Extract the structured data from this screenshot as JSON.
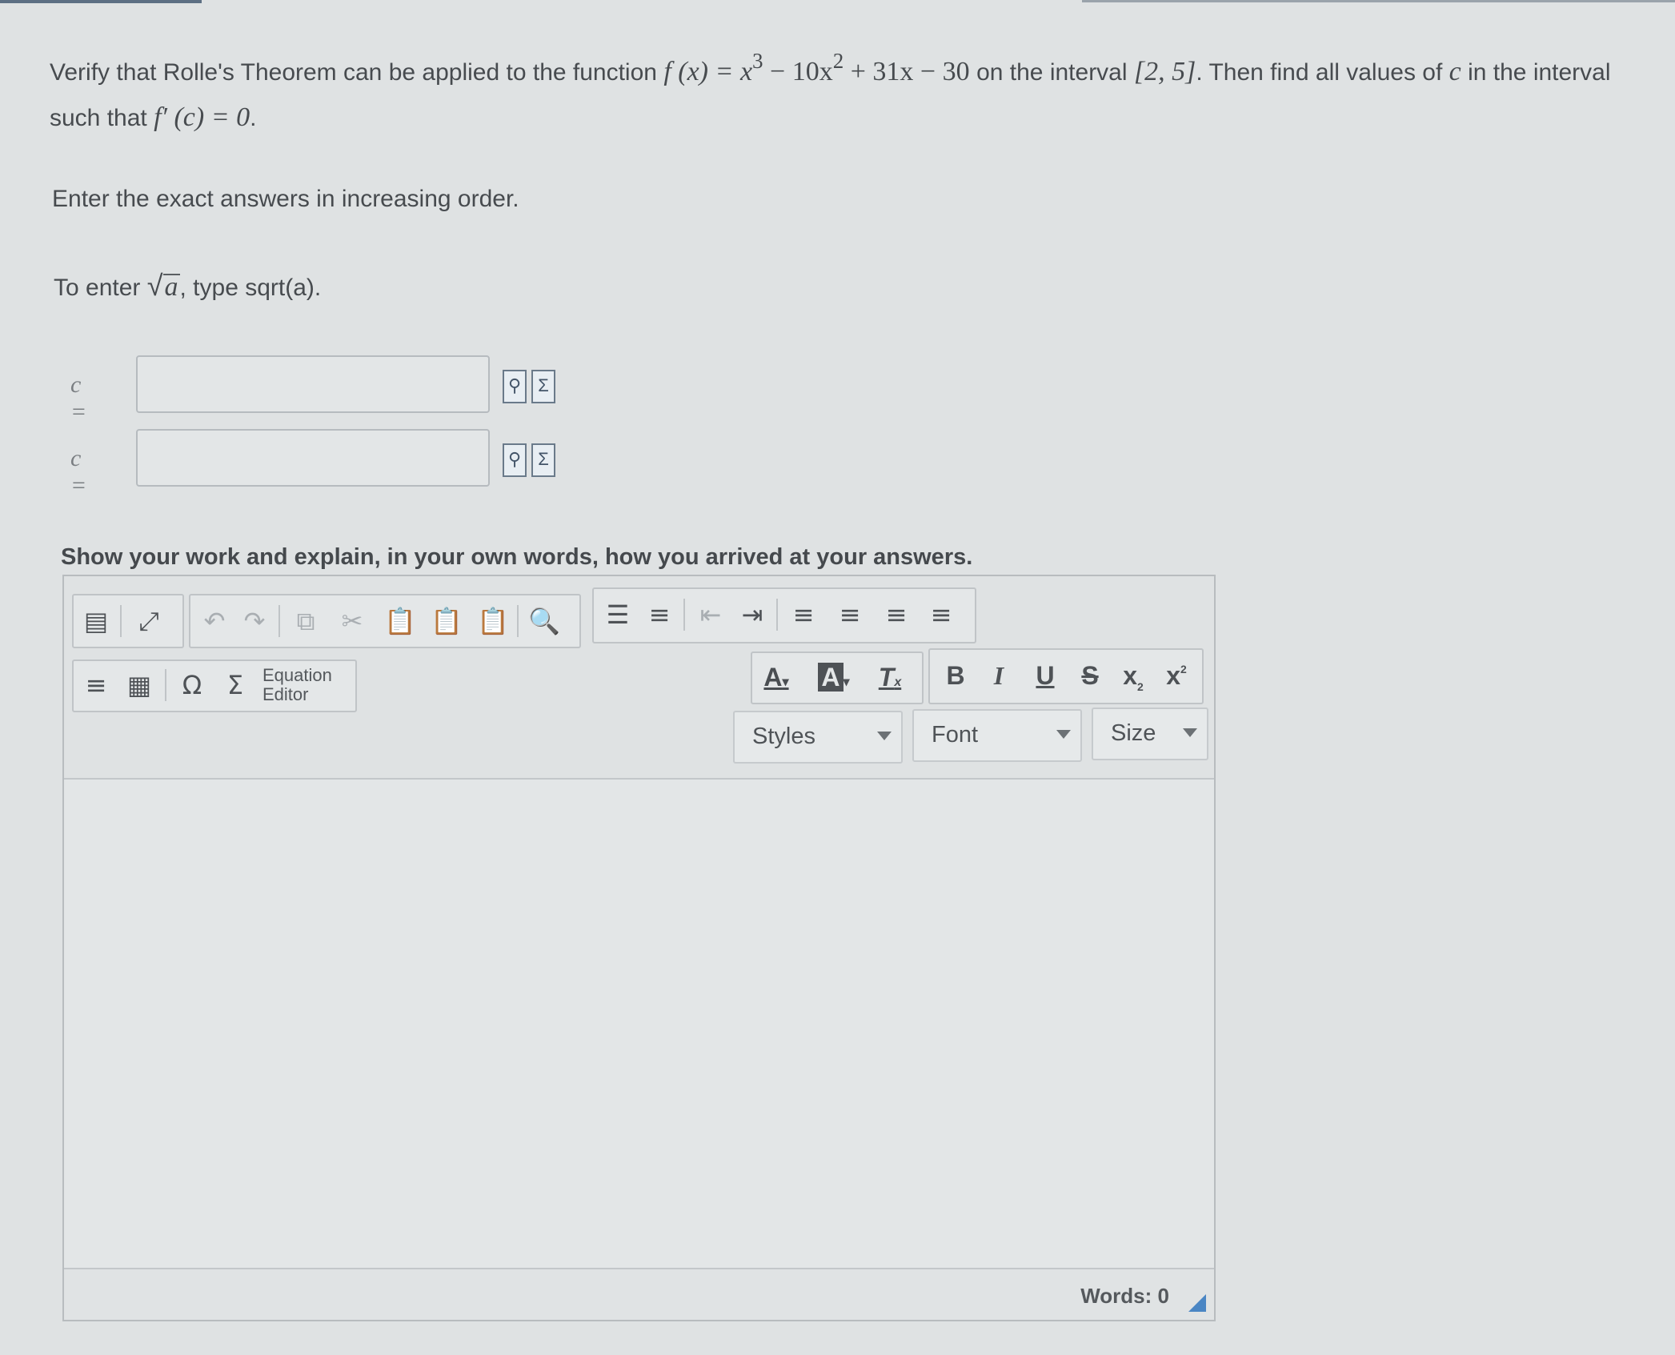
{
  "question": {
    "line1_before": "Verify that Rolle's Theorem can be applied to the function",
    "function_lhs": "f (x) =",
    "term1_base": "x",
    "term1_exp": "3",
    "term2_coef": "− 10x",
    "term2_exp": "2",
    "term3": "+ 31x − 30",
    "line1_middle": "on the interval",
    "interval": "[2, 5]",
    "line1_after": ". Then find all values of",
    "c_var": "c",
    "line1_end": "in the interval",
    "line2_before": "such that",
    "line2_math": "f′ (c) = 0",
    "line2_after": "."
  },
  "instruction": "Enter the exact answers in increasing order.",
  "hint": {
    "before": "To enter",
    "radicand": "a",
    "after": ", type sqrt(a)."
  },
  "answers": [
    {
      "label": "c =",
      "value": ""
    },
    {
      "label": "c =",
      "value": ""
    }
  ],
  "work_prompt": "Show your work and explain, in your own words, how you arrived at your answers.",
  "editor": {
    "equation_editor_label_1": "Equation",
    "equation_editor_label_2": "Editor",
    "font_color_label": "A",
    "bg_color_label": "A",
    "clear_format_label": "T",
    "bold_label": "B",
    "italic_label": "I",
    "underline_label": "U",
    "strike_label": "S",
    "subscript_label": "x",
    "superscript_label": "x",
    "styles_label": "Styles",
    "font_label": "Font",
    "size_label": "Size",
    "body_text": "",
    "words_label": "Words: 0"
  }
}
